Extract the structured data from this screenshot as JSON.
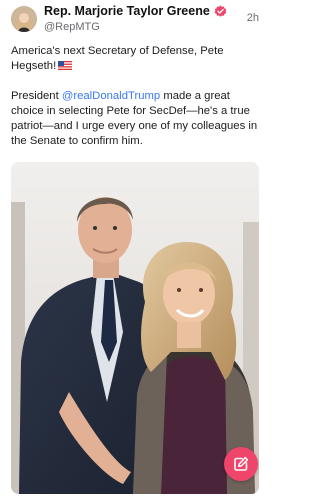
{
  "post": {
    "author": {
      "display_name": "Rep. Marjorie Taylor Greene",
      "handle": "@RepMTG",
      "verified": true,
      "avatar": "profile-avatar"
    },
    "timestamp": "2h",
    "text": {
      "line1": "America's next Secretary of Defense, Pete Hegseth!",
      "line1_emoji": "us-flag-emoji",
      "p2_prefix": "President ",
      "p2_mention": "@realDonaldTrump",
      "p2_suffix": " made a great choice in selecting Pete for SecDef—he's a true patriot—and I urge every one of my colleagues in the Senate to confirm him."
    },
    "image": {
      "description_icon": "photo-two-people"
    }
  },
  "compose_button": {
    "icon": "compose-icon"
  },
  "colors": {
    "mention": "#3a78f2",
    "verified_badge": "#f0456b",
    "compose_fab": "#f0456b"
  }
}
